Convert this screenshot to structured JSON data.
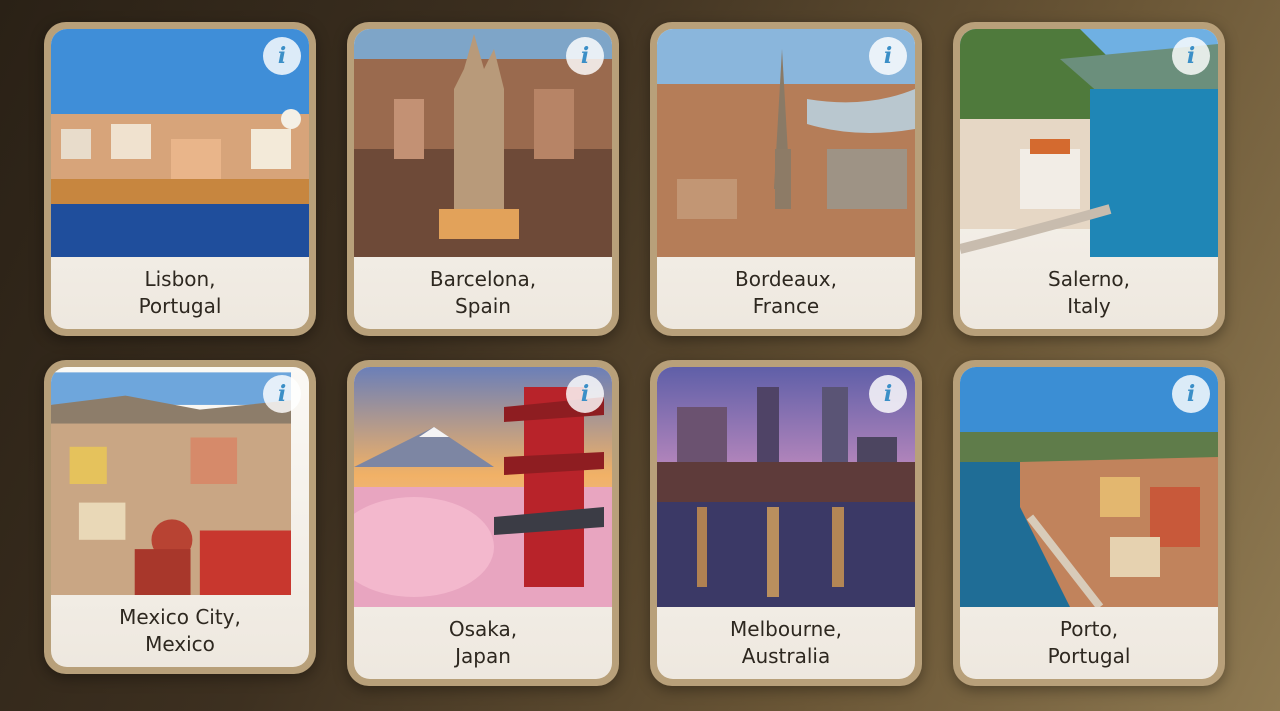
{
  "destinations": [
    {
      "city": "Lisbon,",
      "country": "Portugal",
      "icon": "info-icon"
    },
    {
      "city": "Barcelona,",
      "country": "Spain",
      "icon": "info-icon"
    },
    {
      "city": "Bordeaux,",
      "country": "France",
      "icon": "info-icon"
    },
    {
      "city": "Salerno,",
      "country": "Italy",
      "icon": "info-icon"
    },
    {
      "city": "Mexico City,",
      "country": "Mexico",
      "icon": "info-icon"
    },
    {
      "city": "Osaka,",
      "country": "Japan",
      "icon": "info-icon"
    },
    {
      "city": "Melbourne,",
      "country": "Australia",
      "icon": "info-icon"
    },
    {
      "city": "Porto,",
      "country": "Portugal",
      "icon": "info-icon"
    }
  ],
  "info_glyph": "i",
  "colors": {
    "card_border": "#b8a07a",
    "info_accent": "#3b8fc7",
    "label_text": "#2e2820"
  }
}
